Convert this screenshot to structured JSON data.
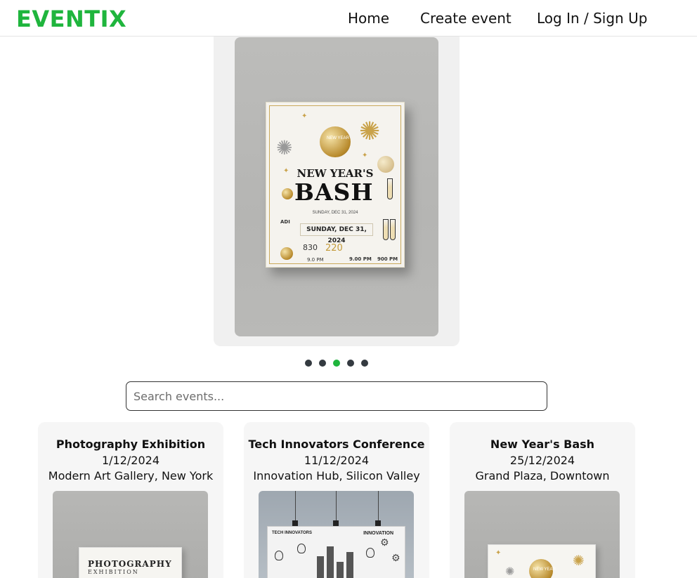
{
  "navbar": {
    "logo": "EVENTIX",
    "links": [
      "Home",
      "Create event",
      "Log In / Sign Up"
    ]
  },
  "carousel": {
    "active_slide": 3,
    "slide_count": 5,
    "poster": {
      "heading_line1": "NEW YEAR'S",
      "heading_line2": "BASH",
      "balloon_text": "NEW YEAR",
      "subline": "SUNDAY, DEC 31, 2024",
      "date_box": "SUNDAY, DEC 31, 2024",
      "left_label": "ADI",
      "num1": "830",
      "num2": "220",
      "time1": "9.0 PM",
      "time2": "9.00 PM",
      "time3": "900 PM"
    }
  },
  "search": {
    "placeholder": "Search events...",
    "value": ""
  },
  "events": [
    {
      "title": "Photography Exhibition",
      "date": "1/12/2024",
      "location": "Modern Art Gallery, New York",
      "poster_line1": "PHOTOGRAPHY",
      "poster_line2": "EXHIBITION"
    },
    {
      "title": "Tech Innovators Conference",
      "date": "11/12/2024",
      "location": "Innovation Hub, Silicon Valley",
      "poster_line1": "TECH INNOVATORS",
      "poster_line2": "INNOVATION"
    },
    {
      "title": "New Year's Bash",
      "date": "25/12/2024",
      "location": "Grand Plaza, Downtown",
      "poster_line1": "NEW YEAR",
      "poster_line2": ""
    }
  ],
  "colors": {
    "brand": "#1fb53d",
    "dot_inactive": "#343a40",
    "card_bg": "#f6f6f6"
  }
}
